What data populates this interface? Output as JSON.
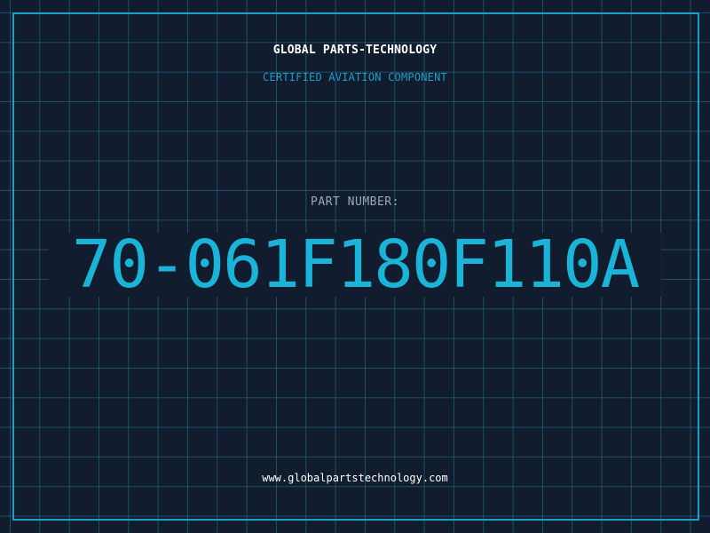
{
  "header": {
    "company": "GLOBAL PARTS-TECHNOLOGY",
    "subtitle": "CERTIFIED AVIATION COMPONENT"
  },
  "part": {
    "label": "PART NUMBER:",
    "number": "70-061F180F110A"
  },
  "footer": {
    "website": "www.globalpartstechnology.com"
  },
  "colors": {
    "background": "#111c2e",
    "grid": "#28788f",
    "accent": "#1a9fc8",
    "part_number": "#1ab4d8",
    "label": "#9aa8b8",
    "text": "#ffffff"
  }
}
